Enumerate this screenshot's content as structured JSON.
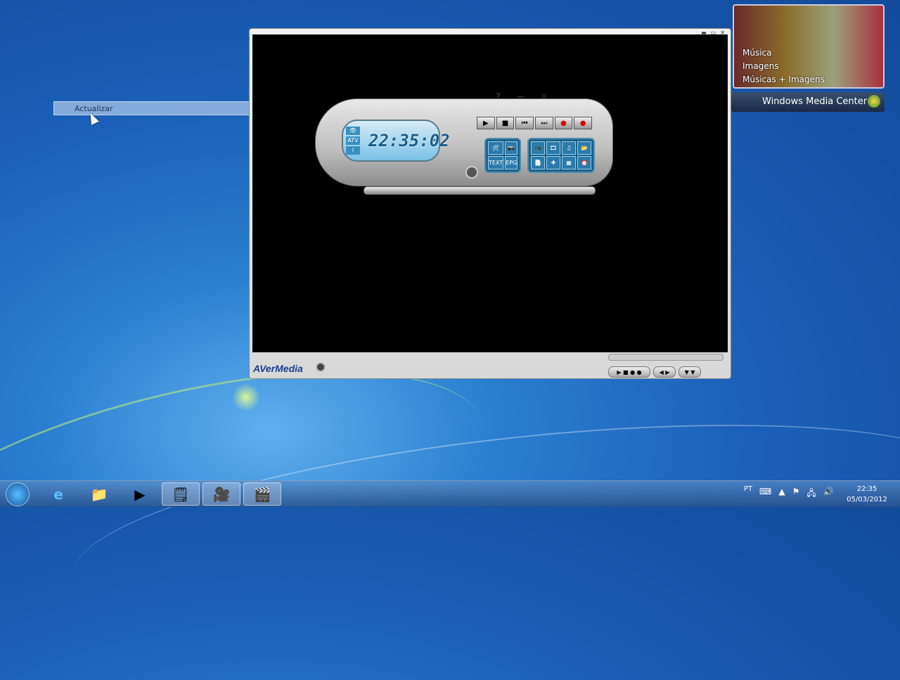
{
  "tooltip": {
    "label": "Actualizar"
  },
  "player": {
    "brand": "AVerMedia",
    "clock": "22:35:02",
    "lcd_icons": [
      "👁",
      "ATV",
      "I"
    ],
    "top_controls": [
      "?",
      "—",
      "✕"
    ],
    "transport": [
      "▶",
      "■",
      "⏮",
      "⏭",
      "●",
      "●"
    ],
    "group1": [
      "🛠",
      "📷",
      "TEXT",
      "EPG"
    ],
    "group2": [
      "📺",
      "🎞",
      "♫",
      "📂",
      "📄",
      "✚",
      "▦",
      "⏰"
    ],
    "mini_controls": [
      "▶ ■ ● ●",
      "◀ ▶",
      "▼ ▼"
    ]
  },
  "media_center": {
    "items": [
      "Música",
      "Imagens",
      "Músicas + Imagens"
    ],
    "title": "Windows Media Center"
  },
  "taskbar": {
    "apps": [
      "e",
      "📁",
      "▶",
      "🗒",
      "🎥",
      "🎬"
    ],
    "lang": "PT",
    "time": "22:35",
    "date": "05/03/2012"
  }
}
